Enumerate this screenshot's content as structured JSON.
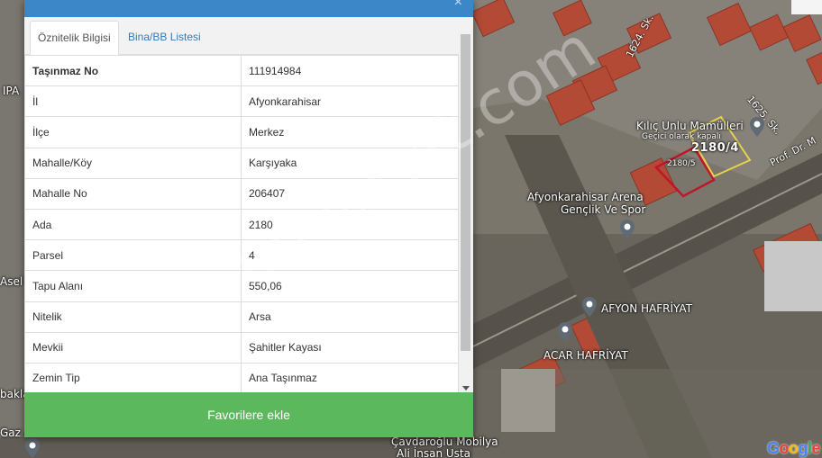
{
  "tabs": [
    "Öznitelik Bilgisi",
    "Bina/BB Listesi"
  ],
  "attributes": [
    {
      "key": "Taşınmaz No",
      "value": "111914984"
    },
    {
      "key": "İl",
      "value": "Afyonkarahisar"
    },
    {
      "key": "İlçe",
      "value": "Merkez"
    },
    {
      "key": "Mahalle/Köy",
      "value": "Karşıyaka"
    },
    {
      "key": "Mahalle No",
      "value": "206407"
    },
    {
      "key": "Ada",
      "value": "2180"
    },
    {
      "key": "Parsel",
      "value": "4"
    },
    {
      "key": "Tapu Alanı",
      "value": "550,06"
    },
    {
      "key": "Nitelik",
      "value": "Arsa"
    },
    {
      "key": "Mevkii",
      "value": "Şahitler Kayası"
    },
    {
      "key": "Zemin Tip",
      "value": "Ana Taşınmaz"
    }
  ],
  "favorite_button": "Favorilere ekle",
  "watermark": "emlakjet.com",
  "map": {
    "labels": {
      "kilic": "Kılıç Unlu Mamülleri",
      "kilic_sub": "Geçici olarak kapalı",
      "parcel_a": "2180/4",
      "parcel_b": "2180/5",
      "arena1": "Afyonkarahisar Arena",
      "arena2": "Gençlik Ve Spor",
      "afyon_hafriyat": "AFYON HAFRİYAT",
      "acar_hafriyat": "ACAR HAFRİYAT",
      "cavdaroglu": "Çavdaroğlu Mobilya",
      "ali_insan": "Ali İnsan Usta",
      "street_1624": "1624. Sk.",
      "street_1625": "1625. Sk.",
      "street_prof": "Prof. Dr. M",
      "left_ipa": "IPA",
      "left_asel": "Asel",
      "left_bakla": "bakla",
      "left_gaz": "Gaz A"
    },
    "google": [
      "G",
      "o",
      "o",
      "g",
      "l",
      "e"
    ]
  },
  "colors": {
    "header": "#3c87c8",
    "button": "#5cb85c",
    "parcel_selected": "#c0152a",
    "parcel_neighbor": "#e8d24a"
  }
}
